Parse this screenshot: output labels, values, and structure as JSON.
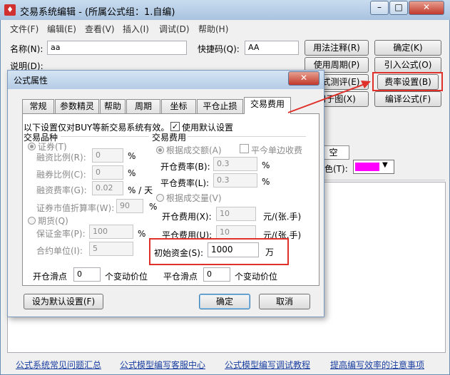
{
  "window": {
    "title": "交易系统编辑 - (所属公式组：1.自编)",
    "minimize": "–",
    "maximize": "□",
    "close": "✕"
  },
  "menu": [
    "文件(F)",
    "编辑(E)",
    "查看(V)",
    "插入(I)",
    "调试(D)",
    "帮助(H)"
  ],
  "form": {
    "name_label": "名称(N):",
    "name_value": "aa",
    "shortcut_label": "快捷码(Q):",
    "shortcut_value": "AA",
    "desc_label": "说明(D):"
  },
  "right_buttons": {
    "usage": "用法注释(R)",
    "ok": "确定(K)",
    "period": "使用周期(P)",
    "import": "引入公式(O)",
    "test": "公式测评(E)",
    "fee": "费率设置(B)",
    "chart": "用于图(X)",
    "compile": "编译公式(F)"
  },
  "behind": {
    "tab_partial": "空",
    "color_label": "色(T):",
    "color_value": "#ff00ff"
  },
  "dialog": {
    "title": "公式属性",
    "tabs": [
      "常规",
      "参数精灵",
      "帮助",
      "周期",
      "坐标",
      "平仓止损",
      "交易费用"
    ],
    "active_tab": "交易费用",
    "note": "以下设置仅对BUY等新交易系统有效。",
    "use_default": {
      "label": "使用默认设置",
      "checked": "✓"
    },
    "varieties": {
      "heading": "交易品种",
      "securities": "证券(T)",
      "margin_ratio": {
        "label": "融资比例(R):",
        "value": "0",
        "unit": "%"
      },
      "short_ratio": {
        "label": "融券比例(C):",
        "value": "0",
        "unit": "%"
      },
      "financing_rate": {
        "label": "融资费率(G):",
        "value": "0.02",
        "unit": "% / 天"
      },
      "market_value_rate": {
        "label": "证券市值折算率(W):",
        "value": "90",
        "unit": "%"
      },
      "futures": "期货(Q)",
      "deposit_rate": {
        "label": "保证金率(P):",
        "value": "100",
        "unit": "%"
      },
      "contract_unit": {
        "label": "合约单位(I):",
        "value": "5"
      }
    },
    "fees": {
      "heading": "交易费用",
      "by_amount": "根据成交额(A)",
      "close_today_single": "平今单边收费",
      "open_rate": {
        "label": "开仓费率(B):",
        "value": "0.3",
        "unit": "%"
      },
      "close_rate": {
        "label": "平仓费率(L):",
        "value": "0.3",
        "unit": "%"
      },
      "by_volume": "根据成交量(V)",
      "open_fee": {
        "label": "开仓费用(X):",
        "value": "10",
        "unit": "元/(张.手)"
      },
      "close_fee": {
        "label": "平仓费用(U):",
        "value": "10",
        "unit": "元/(张.手)"
      },
      "initial_capital": {
        "label": "初始资金(S):",
        "value": "1000",
        "unit": "万"
      }
    },
    "slippage": {
      "open_label": "开仓滑点",
      "open_value": "0",
      "open_unit": "个变动价位",
      "close_label": "平仓滑点",
      "close_value": "0",
      "close_unit": "个变动价位"
    },
    "buttons": {
      "set_default": "设为默认设置(F)",
      "ok": "确定",
      "cancel": "取消"
    }
  },
  "footer_links": [
    "公式系统常见问题汇总",
    "公式模型编写客服中心",
    "公式模型编写调试教程",
    "提高编写效率的注意事项"
  ]
}
